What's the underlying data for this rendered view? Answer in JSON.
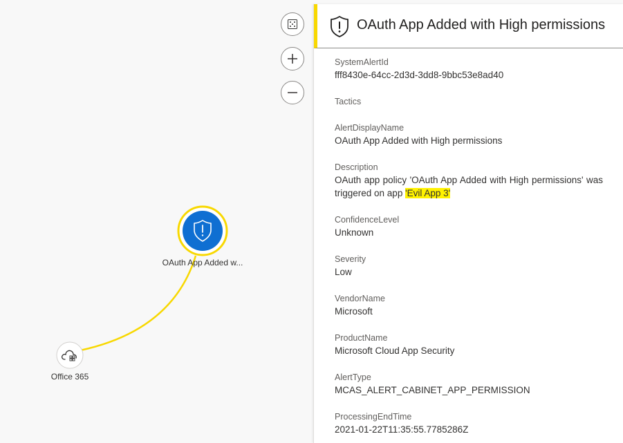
{
  "graph": {
    "alert_node": {
      "label": "OAuth App Added w...",
      "icon": "shield-alert-icon",
      "fill_color": "#0f6fd2",
      "ring_color": "#f8d800"
    },
    "office_node": {
      "label": "Office 365",
      "icon": "cloud-apps-icon"
    },
    "edge_color": "#f8d800",
    "controls": {
      "fit": "fit-view-icon",
      "zoom_in": "plus-icon",
      "zoom_out": "minus-icon"
    }
  },
  "panel": {
    "title": "OAuth App Added with High permissions",
    "title_icon": "shield-alert-icon",
    "accent_color": "#f8d800",
    "fields": {
      "system_alert_id": {
        "name": "SystemAlertId",
        "value": "fff8430e-64cc-2d3d-3dd8-9bbc53e8ad40"
      },
      "tactics": {
        "name": "Tactics"
      },
      "alert_display_name": {
        "name": "AlertDisplayName",
        "value": "OAuth App Added with High permissions"
      },
      "description": {
        "name": "Description",
        "value_prefix": "OAuth app policy 'OAuth App Added with High permissions' was triggered on app ",
        "value_highlight": "'Evil App 3'"
      },
      "confidence_level": {
        "name": "ConfidenceLevel",
        "value": "Unknown"
      },
      "severity": {
        "name": "Severity",
        "value": "Low"
      },
      "vendor_name": {
        "name": "VendorName",
        "value": "Microsoft"
      },
      "product_name": {
        "name": "ProductName",
        "value": "Microsoft Cloud App Security"
      },
      "alert_type": {
        "name": "AlertType",
        "value": "MCAS_ALERT_CABINET_APP_PERMISSION"
      },
      "processing_end_time": {
        "name": "ProcessingEndTime",
        "value": "2021-01-22T11:35:55.7785286Z"
      }
    }
  }
}
